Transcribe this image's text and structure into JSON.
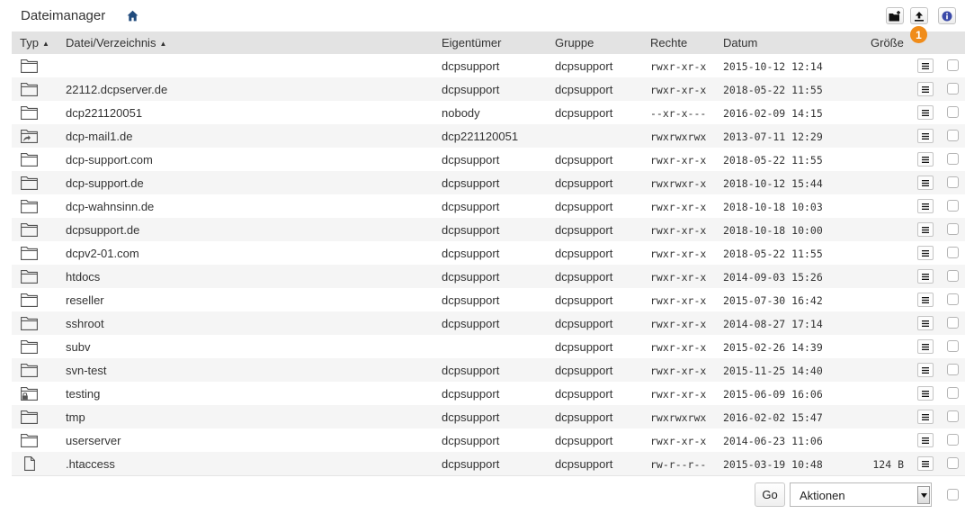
{
  "header": {
    "title": "Dateimanager",
    "home_icon": "home-icon",
    "toolbar": [
      {
        "name": "new-folder-button",
        "icon": "folder-plus-icon"
      },
      {
        "name": "upload-button",
        "icon": "upload-icon"
      },
      {
        "name": "info-button",
        "icon": "info-icon"
      }
    ],
    "badge": "1"
  },
  "colors": {
    "badge": "#f08c1a",
    "header_bg": "#e3e3e3",
    "row_alt": "#f5f5f5",
    "home_icon": "#1f4a7c"
  },
  "table": {
    "columns": {
      "type": "Typ",
      "name": "Datei/Verzeichnis",
      "owner": "Eigentümer",
      "group": "Gruppe",
      "perms": "Rechte",
      "date": "Datum",
      "size": "Größe"
    },
    "rows": [
      {
        "type": "folder",
        "name": "",
        "owner": "dcpsupport",
        "group": "dcpsupport",
        "perms": "rwxr-xr-x",
        "date": "2015-10-12 12:14",
        "size": ""
      },
      {
        "type": "folder",
        "name": "22112.dcpserver.de",
        "owner": "dcpsupport",
        "group": "dcpsupport",
        "perms": "rwxr-xr-x",
        "date": "2018-05-22 11:55",
        "size": ""
      },
      {
        "type": "folder",
        "name": "dcp221120051",
        "owner": "nobody",
        "group": "dcpsupport",
        "perms": "--xr-x---",
        "date": "2016-02-09 14:15",
        "size": ""
      },
      {
        "type": "folder-link",
        "name": "dcp-mail1.de",
        "owner": "dcp221120051",
        "group": "",
        "perms": "rwxrwxrwx",
        "date": "2013-07-11 12:29",
        "size": ""
      },
      {
        "type": "folder",
        "name": "dcp-support.com",
        "owner": "dcpsupport",
        "group": "dcpsupport",
        "perms": "rwxr-xr-x",
        "date": "2018-05-22 11:55",
        "size": ""
      },
      {
        "type": "folder",
        "name": "dcp-support.de",
        "owner": "dcpsupport",
        "group": "dcpsupport",
        "perms": "rwxrwxr-x",
        "date": "2018-10-12 15:44",
        "size": ""
      },
      {
        "type": "folder",
        "name": "dcp-wahnsinn.de",
        "owner": "dcpsupport",
        "group": "dcpsupport",
        "perms": "rwxr-xr-x",
        "date": "2018-10-18 10:03",
        "size": ""
      },
      {
        "type": "folder",
        "name": "dcpsupport.de",
        "owner": "dcpsupport",
        "group": "dcpsupport",
        "perms": "rwxr-xr-x",
        "date": "2018-10-18 10:00",
        "size": ""
      },
      {
        "type": "folder",
        "name": "dcpv2-01.com",
        "owner": "dcpsupport",
        "group": "dcpsupport",
        "perms": "rwxr-xr-x",
        "date": "2018-05-22 11:55",
        "size": ""
      },
      {
        "type": "folder",
        "name": "htdocs",
        "owner": "dcpsupport",
        "group": "dcpsupport",
        "perms": "rwxr-xr-x",
        "date": "2014-09-03 15:26",
        "size": ""
      },
      {
        "type": "folder",
        "name": "reseller",
        "owner": "dcpsupport",
        "group": "dcpsupport",
        "perms": "rwxr-xr-x",
        "date": "2015-07-30 16:42",
        "size": ""
      },
      {
        "type": "folder",
        "name": "sshroot",
        "owner": "dcpsupport",
        "group": "dcpsupport",
        "perms": "rwxr-xr-x",
        "date": "2014-08-27 17:14",
        "size": ""
      },
      {
        "type": "folder",
        "name": "subv",
        "owner": "",
        "group": "dcpsupport",
        "perms": "rwxr-xr-x",
        "date": "2015-02-26 14:39",
        "size": ""
      },
      {
        "type": "folder",
        "name": "svn-test",
        "owner": "dcpsupport",
        "group": "dcpsupport",
        "perms": "rwxr-xr-x",
        "date": "2015-11-25 14:40",
        "size": ""
      },
      {
        "type": "folder-locked",
        "name": "testing",
        "owner": "dcpsupport",
        "group": "dcpsupport",
        "perms": "rwxr-xr-x",
        "date": "2015-06-09 16:06",
        "size": ""
      },
      {
        "type": "folder",
        "name": "tmp",
        "owner": "dcpsupport",
        "group": "dcpsupport",
        "perms": "rwxrwxrwx",
        "date": "2016-02-02 15:47",
        "size": ""
      },
      {
        "type": "folder",
        "name": "userserver",
        "owner": "dcpsupport",
        "group": "dcpsupport",
        "perms": "rwxr-xr-x",
        "date": "2014-06-23 11:06",
        "size": ""
      },
      {
        "type": "file",
        "name": ".htaccess",
        "owner": "dcpsupport",
        "group": "dcpsupport",
        "perms": "rw-r--r--",
        "date": "2015-03-19 10:48",
        "size": "124 B"
      }
    ]
  },
  "footer": {
    "go_label": "Go",
    "actions_label": "Aktionen"
  }
}
